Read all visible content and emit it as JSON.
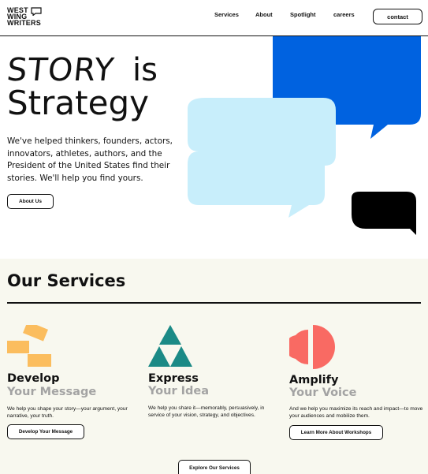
{
  "header": {
    "logo_lines": [
      "WEST",
      "WING",
      "WRITERS"
    ],
    "nav": [
      "Services",
      "About",
      "Spotlight",
      "careers"
    ],
    "contact_label": "contact"
  },
  "hero": {
    "title_word1": "STORY",
    "title_word2": "is",
    "title_line2": "Strategy",
    "description": "We've helped thinkers, founders, actors, innovators, athletes, authors, and the President of the United States find their stories. We'll help you find yours.",
    "cta_label": "About Us"
  },
  "services": {
    "title": "Our Services",
    "items": [
      {
        "title1": "Develop",
        "title2": "Your Message",
        "description": "We help you shape your story—your argument, your narrative, your truth.",
        "button": "Develop Your Message",
        "icon": "offset-blocks-icon",
        "color": "#fbbd5e"
      },
      {
        "title1": "Express",
        "title2": "Your Idea",
        "description": "We help you share it—memorably, persuasively, in service of your vision, strategy, and objectives.",
        "button": "",
        "icon": "triangles-icon",
        "color": "#1b8a86"
      },
      {
        "title1": "Amplify",
        "title2": "Your Voice",
        "description": "And we help you maximize its reach and impact—to move your audiences and mobilize them.",
        "button": "Learn More About Workshops",
        "icon": "half-circles-icon",
        "color": "#f96a63"
      }
    ],
    "explore_label": "Explore Our Services"
  },
  "colors": {
    "blue_bubble": "#0062e0",
    "light_blue_bubble": "#c8eefb",
    "black_bubble": "#000000",
    "services_bg": "#f8f8ef"
  }
}
